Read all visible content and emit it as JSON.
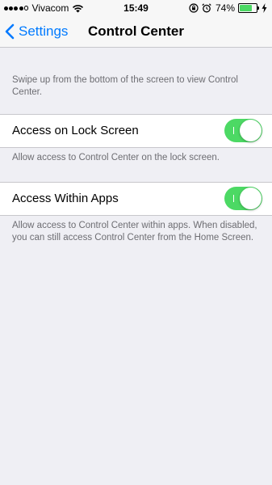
{
  "status_bar": {
    "carrier": "Vivacom",
    "time": "15:49",
    "battery_percent": "74%",
    "battery_level": 0.74,
    "signal_bars": 4,
    "icons": [
      "wifi-icon",
      "rotation-lock-icon",
      "alarm-icon",
      "battery-icon",
      "charging-bolt-icon"
    ]
  },
  "nav": {
    "back_label": "Settings",
    "title": "Control Center"
  },
  "intro_note": "Swipe up from the bottom of the screen to view Control Center.",
  "settings": [
    {
      "label": "Access on Lock Screen",
      "enabled": true,
      "footer": "Allow access to Control Center on the lock screen."
    },
    {
      "label": "Access Within Apps",
      "enabled": true,
      "footer": "Allow access to Control Center within apps. When disabled, you can still access Control Center from the Home Screen."
    }
  ],
  "colors": {
    "accent": "#007aff",
    "switch_on": "#4cd964",
    "background": "#efeff4",
    "footer_text": "#6d6d72"
  }
}
